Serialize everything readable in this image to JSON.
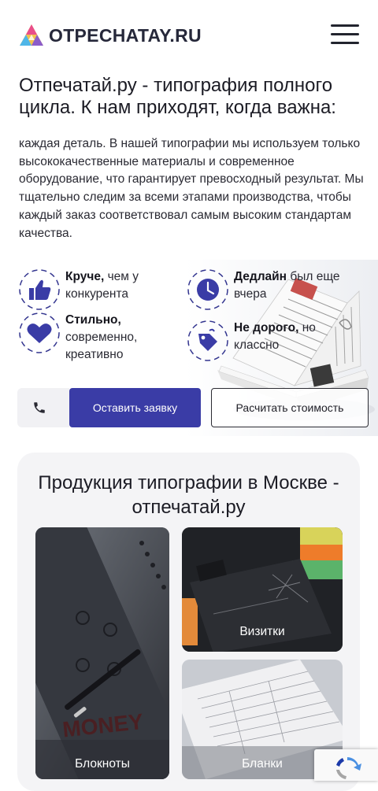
{
  "header": {
    "logo_text": "OTPECHATAY.RU",
    "menu_icon": "hamburger-menu-icon"
  },
  "hero": {
    "title": "Отпечатай.ру - типография полного цикла. К нам приходят, когда важна:",
    "description": "каждая деталь. В нашей типографии мы используем только высококачественные материалы и современное оборудование, что гарантирует превосходный результат. Мы тщательно следим за всеми этапами производства, чтобы каждый заказ соответствовал самым высоким стандартам качества."
  },
  "features": [
    {
      "bold": "Круче,",
      "text": " чем у конкурента",
      "icon": "thumbs-up-icon"
    },
    {
      "bold": "Дедлайн",
      "text": " был еще вчера",
      "icon": "clock-icon"
    },
    {
      "bold": "Стильно,",
      "text": " современно, креативно",
      "icon": "heart-icon"
    },
    {
      "bold": "Не дорого,",
      "text": " но классно",
      "icon": "price-tag-icon"
    }
  ],
  "actions": {
    "phone_icon": "phone-icon",
    "request_label": "Оставить заявку",
    "calc_label": "Расчитать стоимость"
  },
  "products": {
    "title": "Продукция типографии в Москве - отпечатай.ру",
    "cards": [
      {
        "label": "Блокноты",
        "image": "notebook-photo"
      },
      {
        "label": "Визитки",
        "image": "business-cards-photo"
      },
      {
        "label": "Бланки",
        "image": "forms-photo"
      }
    ],
    "notebook_print": "MONEY"
  },
  "colors": {
    "accent": "#3a3ca6",
    "icon_blue": "#33358f",
    "text": "#1c1c28",
    "panel_bg": "#f4f4f6"
  }
}
